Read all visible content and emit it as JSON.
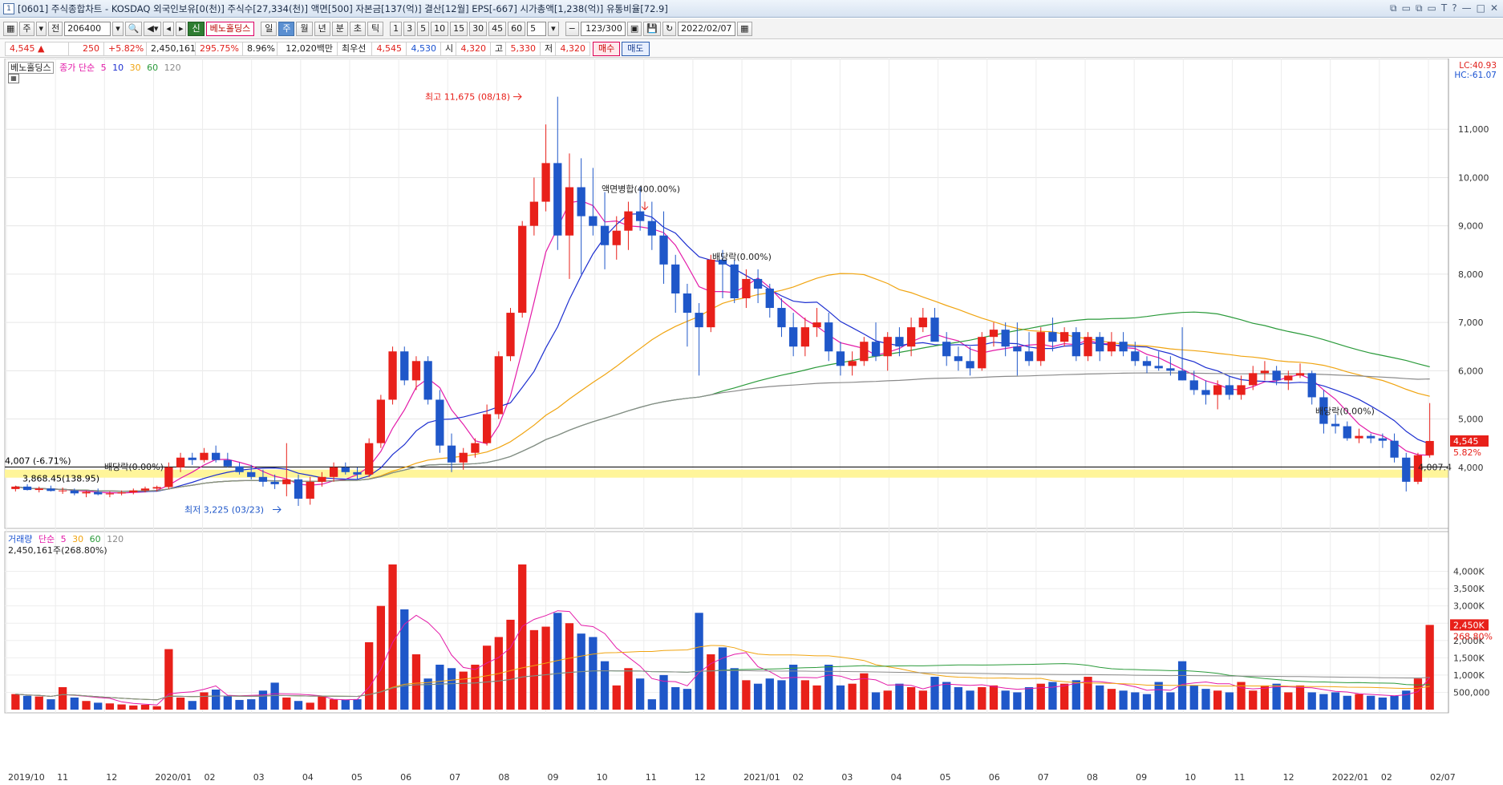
{
  "window": {
    "number": "1",
    "title": "[0601] 주식종합차트 - KOSDAQ 외국인보유[0(천)] 주식수[27,334(천)] 액면[500] 자본금[137(억)] 결산[12월] EPS[-667] 시가총액[1,238(억)] 유통비율[72.9]",
    "controls": [
      "⧉",
      "▭",
      "⧉",
      "▭",
      "T",
      "?",
      "—",
      "□",
      "✕"
    ]
  },
  "toolbar": {
    "market": "주",
    "prefix": "전",
    "code": "206400",
    "new_badge": "신",
    "name": "베노홀딩스",
    "periods": [
      "일",
      "주",
      "월",
      "년",
      "분",
      "초",
      "틱"
    ],
    "active_period": "주",
    "intervals": [
      "1",
      "3",
      "5",
      "10",
      "15",
      "30",
      "45",
      "60"
    ],
    "interval_value": "5",
    "count": "123/300",
    "date": "2022/02/07"
  },
  "info": {
    "price": "4,545",
    "arrow": "▲",
    "change": "250",
    "change_pct": "+5.82%",
    "volume": "2,450,161",
    "vol_ratio": "295.75%",
    "turnover": "8.96%",
    "amount": "12,020백만",
    "best_ask_label": "최우선",
    "best_ask": "4,545",
    "best_bid": "4,530",
    "open_label": "시",
    "open": "4,320",
    "high_label": "고",
    "high": "5,330",
    "low_label": "저",
    "low": "4,320",
    "buy": "매수",
    "sell": "매도"
  },
  "price_panel": {
    "legend_name": "베노홀딩스",
    "legend_ma": "종가 단순",
    "ma_periods": [
      "5",
      "10",
      "30",
      "60",
      "120"
    ],
    "lc": "LC:40.93",
    "hc": "HC:-61.07",
    "current_tag": "4,545",
    "current_pct": "5.82%",
    "level_label": "4,007.4",
    "left_level": "4,007 (-6.71%)",
    "left_level2": "3,868.45(138.95)",
    "ann_high": "최고 11,675 (08/18)",
    "ann_low": "최저 3,225 (03/23)",
    "ann_split": "액면병합(400.00%)",
    "ann_div1": "배당락(0.00%)",
    "ann_div2": "배당락(0.00%)",
    "ann_div3": "배당락(0.00%)"
  },
  "volume_panel": {
    "legend_name": "거래량",
    "legend_ma": "단순",
    "ma_periods": [
      "5",
      "30",
      "60",
      "120"
    ],
    "current_text": "2,450,161주(268.80%)",
    "current_tag": "2,450K",
    "current_pct": "268.80%"
  },
  "colors": {
    "up": "#e8201a",
    "down": "#1f57c9",
    "ma5": "#e31aa8",
    "ma10": "#1d2fd0",
    "ma30": "#f0a410",
    "ma60": "#2a9a3a",
    "ma120": "#8a8a8a",
    "highlight": "#fff59a"
  },
  "chart_data": {
    "type": "candlestick",
    "price_axis": {
      "min": 3000,
      "max": 12000,
      "ticks": [
        "4,000",
        "5,000",
        "6,000",
        "7,000",
        "8,000",
        "9,000",
        "10,000",
        "11,000"
      ]
    },
    "volume_axis": {
      "max": 4500000,
      "ticks": [
        "500,000",
        "1,000K",
        "1,500K",
        "2,000K",
        "2,500K",
        "3,000K",
        "3,500K",
        "4,000K"
      ]
    },
    "x_labels": [
      "2019/10",
      "11",
      "12",
      "2020/01",
      "02",
      "03",
      "04",
      "05",
      "06",
      "07",
      "08",
      "09",
      "10",
      "11",
      "12",
      "2021/01",
      "02",
      "03",
      "04",
      "05",
      "06",
      "07",
      "08",
      "09",
      "10",
      "11",
      "12",
      "2022/01",
      "02",
      "02/07"
    ],
    "candles": [
      [
        3550,
        3620,
        3500,
        3600,
        450000
      ],
      [
        3600,
        3650,
        3520,
        3530,
        400000
      ],
      [
        3530,
        3600,
        3480,
        3560,
        380000
      ],
      [
        3560,
        3620,
        3500,
        3510,
        300000
      ],
      [
        3510,
        3580,
        3450,
        3520,
        650000
      ],
      [
        3520,
        3560,
        3420,
        3460,
        350000
      ],
      [
        3460,
        3520,
        3380,
        3490,
        250000
      ],
      [
        3490,
        3560,
        3420,
        3440,
        200000
      ],
      [
        3440,
        3500,
        3380,
        3460,
        180000
      ],
      [
        3460,
        3520,
        3420,
        3480,
        150000
      ],
      [
        3480,
        3560,
        3440,
        3520,
        120000
      ],
      [
        3520,
        3600,
        3480,
        3560,
        140000
      ],
      [
        3560,
        3620,
        3500,
        3590,
        100000
      ],
      [
        3590,
        4100,
        3550,
        4000,
        1750000
      ],
      [
        4000,
        4300,
        3900,
        4200,
        350000
      ],
      [
        4200,
        4300,
        4050,
        4150,
        250000
      ],
      [
        4150,
        4400,
        4100,
        4300,
        500000
      ],
      [
        4300,
        4450,
        4100,
        4150,
        580000
      ],
      [
        4150,
        4300,
        4000,
        4020,
        400000
      ],
      [
        4020,
        4100,
        3850,
        3900,
        280000
      ],
      [
        3900,
        4050,
        3750,
        3800,
        300000
      ],
      [
        3800,
        3950,
        3600,
        3700,
        550000
      ],
      [
        3700,
        3850,
        3550,
        3650,
        780000
      ],
      [
        3650,
        4500,
        3400,
        3750,
        350000
      ],
      [
        3750,
        3850,
        3200,
        3350,
        250000
      ],
      [
        3350,
        3800,
        3225,
        3700,
        200000
      ],
      [
        3700,
        3900,
        3600,
        3800,
        400000
      ],
      [
        3800,
        4100,
        3700,
        4000,
        300000
      ],
      [
        4000,
        4100,
        3850,
        3900,
        280000
      ],
      [
        3900,
        4000,
        3750,
        3850,
        300000
      ],
      [
        3850,
        4600,
        3800,
        4500,
        1950000
      ],
      [
        4500,
        5500,
        4400,
        5400,
        3000000
      ],
      [
        5400,
        6500,
        5300,
        6400,
        4200000
      ],
      [
        6400,
        6500,
        5700,
        5800,
        2900000
      ],
      [
        5800,
        6300,
        5600,
        6200,
        1600000
      ],
      [
        6200,
        6300,
        5300,
        5400,
        900000
      ],
      [
        5400,
        5600,
        4300,
        4450,
        1300000
      ],
      [
        4450,
        4700,
        3900,
        4100,
        1200000
      ],
      [
        4100,
        4400,
        3950,
        4300,
        1100000
      ],
      [
        4300,
        4600,
        4200,
        4500,
        1300000
      ],
      [
        4500,
        5300,
        4450,
        5100,
        1850000
      ],
      [
        5100,
        6400,
        5000,
        6300,
        2100000
      ],
      [
        6300,
        7300,
        6200,
        7200,
        2600000
      ],
      [
        7200,
        9100,
        7100,
        9000,
        4200000
      ],
      [
        9000,
        10000,
        8800,
        9500,
        2300000
      ],
      [
        9500,
        11100,
        9300,
        10300,
        2400000
      ],
      [
        10300,
        11675,
        8500,
        8800,
        2800000
      ],
      [
        8800,
        10500,
        7900,
        9800,
        2500000
      ],
      [
        9800,
        10400,
        8000,
        9200,
        2200000
      ],
      [
        9200,
        10200,
        8800,
        9000,
        2100000
      ],
      [
        9000,
        9700,
        8100,
        8600,
        1400000
      ],
      [
        8600,
        9200,
        8300,
        8900,
        700000
      ],
      [
        8900,
        9500,
        8500,
        9300,
        1200000
      ],
      [
        9300,
        9800,
        8900,
        9100,
        900000
      ],
      [
        9100,
        9500,
        8500,
        8800,
        300000
      ],
      [
        8800,
        9300,
        7800,
        8200,
        1000000
      ],
      [
        8200,
        8400,
        7200,
        7600,
        650000
      ],
      [
        7600,
        7800,
        6500,
        7200,
        600000
      ],
      [
        7200,
        7400,
        5900,
        6900,
        2800000
      ],
      [
        6900,
        8400,
        6800,
        8300,
        1600000
      ],
      [
        8300,
        8500,
        7500,
        8200,
        1800000
      ],
      [
        8200,
        8300,
        7400,
        7500,
        1200000
      ],
      [
        7500,
        8100,
        7300,
        7900,
        850000
      ],
      [
        7900,
        8100,
        7400,
        7700,
        750000
      ],
      [
        7700,
        7800,
        7100,
        7300,
        900000
      ],
      [
        7300,
        7500,
        6700,
        6900,
        850000
      ],
      [
        6900,
        7200,
        6300,
        6500,
        1300000
      ],
      [
        6500,
        7100,
        6300,
        6900,
        850000
      ],
      [
        6900,
        7300,
        6700,
        7000,
        700000
      ],
      [
        7000,
        7200,
        6200,
        6400,
        1300000
      ],
      [
        6400,
        6600,
        5900,
        6100,
        700000
      ],
      [
        6100,
        6400,
        5900,
        6200,
        750000
      ],
      [
        6200,
        6700,
        6100,
        6600,
        1050000
      ],
      [
        6600,
        7000,
        6200,
        6300,
        500000
      ],
      [
        6300,
        6800,
        6000,
        6700,
        550000
      ],
      [
        6700,
        6900,
        6300,
        6500,
        750000
      ],
      [
        6500,
        7100,
        6300,
        6900,
        650000
      ],
      [
        6900,
        7300,
        6800,
        7100,
        550000
      ],
      [
        7100,
        7300,
        6800,
        6600,
        950000
      ],
      [
        6600,
        6800,
        6100,
        6300,
        800000
      ],
      [
        6300,
        6500,
        6000,
        6200,
        650000
      ],
      [
        6200,
        6500,
        5900,
        6050,
        550000
      ],
      [
        6050,
        6800,
        6000,
        6700,
        650000
      ],
      [
        6700,
        7000,
        6500,
        6850,
        700000
      ],
      [
        6850,
        7000,
        6300,
        6500,
        550000
      ],
      [
        6500,
        7000,
        5900,
        6400,
        500000
      ],
      [
        6400,
        6800,
        6100,
        6200,
        650000
      ],
      [
        6200,
        6900,
        6100,
        6800,
        750000
      ],
      [
        6800,
        7100,
        6400,
        6600,
        800000
      ],
      [
        6600,
        6900,
        6500,
        6800,
        750000
      ],
      [
        6800,
        6900,
        6200,
        6300,
        850000
      ],
      [
        6300,
        6800,
        6200,
        6700,
        950000
      ],
      [
        6700,
        6800,
        6200,
        6400,
        700000
      ],
      [
        6400,
        6800,
        6300,
        6600,
        600000
      ],
      [
        6600,
        6800,
        6300,
        6400,
        550000
      ],
      [
        6400,
        6600,
        6100,
        6200,
        500000
      ],
      [
        6200,
        6300,
        5950,
        6100,
        450000
      ],
      [
        6100,
        6400,
        6000,
        6050,
        800000
      ],
      [
        6050,
        6300,
        5900,
        6000,
        500000
      ],
      [
        6000,
        6900,
        5800,
        5800,
        1400000
      ],
      [
        5800,
        6000,
        5500,
        5600,
        700000
      ],
      [
        5600,
        5800,
        5300,
        5500,
        600000
      ],
      [
        5500,
        5800,
        5200,
        5700,
        550000
      ],
      [
        5700,
        5900,
        5400,
        5500,
        500000
      ],
      [
        5500,
        5900,
        5400,
        5700,
        800000
      ],
      [
        5700,
        6100,
        5600,
        5950,
        550000
      ],
      [
        5950,
        6200,
        5800,
        6000,
        700000
      ],
      [
        6000,
        6100,
        5700,
        5800,
        750000
      ],
      [
        5800,
        6000,
        5600,
        5900,
        500000
      ],
      [
        5900,
        6150,
        5850,
        5950,
        700000
      ],
      [
        5950,
        6000,
        5300,
        5450,
        500000
      ],
      [
        5450,
        5600,
        4700,
        4900,
        450000
      ],
      [
        4900,
        5100,
        4700,
        4850,
        500000
      ],
      [
        4850,
        4950,
        4550,
        4600,
        400000
      ],
      [
        4600,
        4800,
        4500,
        4650,
        450000
      ],
      [
        4650,
        4700,
        4500,
        4600,
        400000
      ],
      [
        4600,
        4700,
        4400,
        4550,
        350000
      ],
      [
        4550,
        4700,
        4100,
        4200,
        400000
      ],
      [
        4200,
        4300,
        3500,
        3700,
        550000
      ],
      [
        3700,
        4300,
        3650,
        4250,
        900000
      ],
      [
        4250,
        5330,
        4200,
        4545,
        2450161
      ]
    ],
    "ma_series_names": [
      "5",
      "10",
      "30",
      "60",
      "120"
    ]
  }
}
